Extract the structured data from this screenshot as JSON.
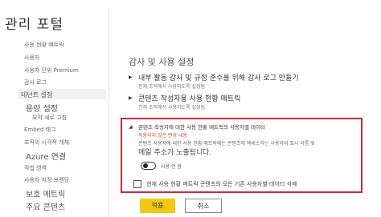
{
  "app": {
    "title": "관리 포털"
  },
  "sidebar": {
    "items": [
      {
        "label": "사용 현황 메트릭"
      },
      {
        "label": "사용자"
      },
      {
        "label": "사용자 단위 Premium"
      },
      {
        "label": "감사 로그"
      },
      {
        "label": "테넌트 설정"
      },
      {
        "label": "용량 설정"
      },
      {
        "label": "요약 새로 고침"
      },
      {
        "label": "Embed 태그"
      },
      {
        "label": "조직의 시각적 개체"
      },
      {
        "label": "Azure 연결"
      },
      {
        "label": "작업 영역"
      },
      {
        "label": "사용자 지정 브랜딩"
      },
      {
        "label": "보호 메트릭"
      },
      {
        "label": "주요 콘텐츠"
      }
    ]
  },
  "main": {
    "title": "감사 및 사용 설정",
    "sections": [
      {
        "title": "내부 활동 감사 및 규정 준수를 위해 감사 로그 만들기",
        "subtitle": "전체 조직에서 사용하도록 설정됨"
      },
      {
        "title": "콘텐츠 작성자용 사용 현황 메트릭",
        "subtitle": "전체 조직에서 사용하도록 설정됨"
      },
      {
        "title": "콘텐츠 작성자에 대한 사용 현황 메트릭의 사용자별 데이터",
        "warning": "적용되지 않은 변경 내용",
        "desc_line1": "콘텐츠 사용자에 대한 사용 현황 메트릭에는 콘텐츠에 액세스하는 사용자의 표시 이름 및",
        "desc_line2": "메일 주소가 노출됩니다.",
        "toggle_label": "사용 안 함",
        "checkbox_label": "현재 사용 현황 메트릭 콘텐츠의 모든 기존 사용자별 데이터 삭제"
      }
    ]
  },
  "buttons": {
    "apply": "적용",
    "cancel": "취소"
  },
  "colors": {
    "apply_bg": "#f2c811",
    "highlight_border": "#d6263a",
    "warning_text": "#d04a32"
  }
}
